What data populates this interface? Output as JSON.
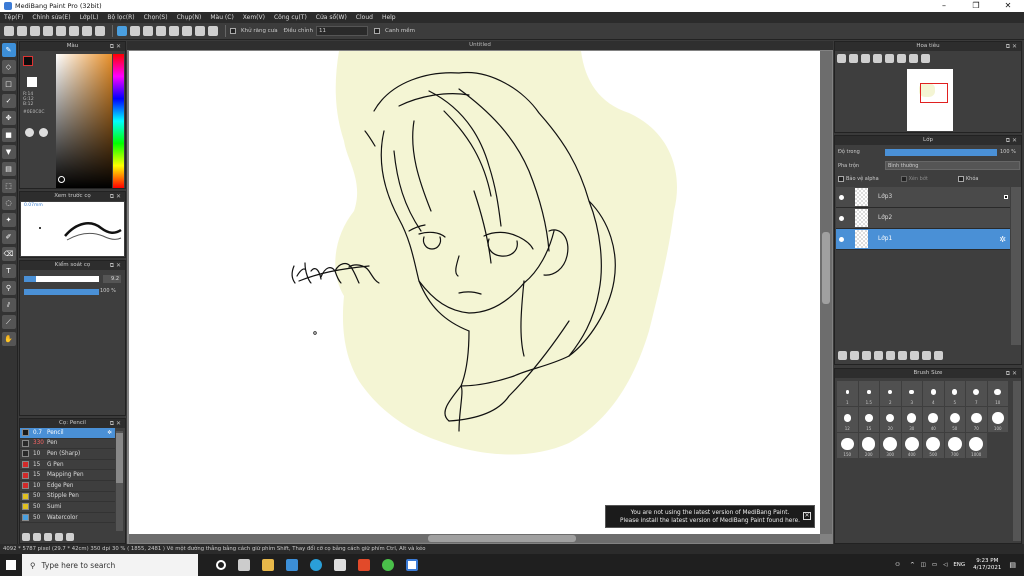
{
  "window": {
    "title": "MediBang Paint Pro (32bit)",
    "controls": [
      "–",
      "❐",
      "✕"
    ]
  },
  "menu": [
    "Tệp(F)",
    "Chỉnh sửa(E)",
    "Lớp(L)",
    "Bộ lọc(R)",
    "Chọn(S)",
    "Chụp(N)",
    "Màu (C)",
    "Xem(V)",
    "Công cụ(T)",
    "Cửa sổ(W)",
    "Cloud",
    "Help"
  ],
  "toolbar": {
    "anti_alias_label": "Khử răng cưa",
    "correction_label": "Điều chỉnh",
    "correction_value": "11",
    "snap_label": "Canh mềm"
  },
  "panels": {
    "color": {
      "title": "Màu",
      "r_label": "R:14",
      "g_label": "G:12",
      "b_label": "B:12",
      "hex": "#0E0C0C"
    },
    "brush_preview": {
      "title": "Xem trước cọ",
      "size": "0.07mm"
    },
    "brush_control": {
      "title": "Kiểm soát cọ",
      "size_value": "9.2",
      "opacity_value": "100 %"
    },
    "brush_list": {
      "title": "Cọ: Pencil",
      "items": [
        {
          "size": "0.7",
          "name": "Pencil",
          "color": "#1a1a1a",
          "selected": true
        },
        {
          "size": "330",
          "name": "Pen",
          "color": "#2a2a2a",
          "selected": false
        },
        {
          "size": "10",
          "name": "Pen (Sharp)",
          "color": "#2a2a2a",
          "selected": false
        },
        {
          "size": "15",
          "name": "G Pen",
          "color": "#d32a2a",
          "selected": false
        },
        {
          "size": "15",
          "name": "Mapping Pen",
          "color": "#d32a2a",
          "selected": false
        },
        {
          "size": "10",
          "name": "Edge Pen",
          "color": "#d32a2a",
          "selected": false
        },
        {
          "size": "50",
          "name": "Stipple Pen",
          "color": "#e0c020",
          "selected": false
        },
        {
          "size": "50",
          "name": "Sumi",
          "color": "#e0c020",
          "selected": false
        },
        {
          "size": "50",
          "name": "Watercolor",
          "color": "#4aa0e0",
          "selected": false
        }
      ]
    },
    "navigator": {
      "title": "Hoa tiêu"
    },
    "layer": {
      "title": "Lớp",
      "opacity_label": "Độ trong",
      "opacity_value": "100 %",
      "blend_label": "Pha trộn",
      "blend_value": "Bình thường",
      "protect_alpha": "Bảo vệ alpha",
      "clipping": "Xén bớt",
      "lock": "Khóa",
      "layers": [
        {
          "name": "Lớp3",
          "selected": false
        },
        {
          "name": "Lớp2",
          "selected": false
        },
        {
          "name": "Lớp1",
          "selected": true
        }
      ]
    },
    "brush_size": {
      "title": "Brush Size",
      "sizes": [
        "1",
        "1.5",
        "2",
        "3",
        "4",
        "5",
        "7",
        "10",
        "12",
        "15",
        "20",
        "30",
        "40",
        "50",
        "70",
        "100",
        "150",
        "200",
        "300",
        "400",
        "500",
        "700",
        "1000"
      ]
    }
  },
  "canvas": {
    "title": "Untitled"
  },
  "notice": {
    "line1": "You are not using the latest version of MediBang Paint.",
    "line2": "Please install the latest version of MediBang Paint found here."
  },
  "statusbar": "4092 * 5787 pixel   (29.7 * 42cm)   350 dpi   30 %   ( 1855, 2481 )   Vẽ một đường thẳng bằng cách giữ phím Shift, Thay đổi cỡ cọ bằng cách giữ phím Ctrl, Alt và kéo",
  "taskbar": {
    "search_placeholder": "Type here to search",
    "lang": "ENG",
    "time": "9:23 PM",
    "date": "4/17/2021"
  },
  "colors": {
    "accent": "#4a90d6",
    "bg": "#3a3a3a",
    "paper_blob": "#f4f5d4"
  }
}
